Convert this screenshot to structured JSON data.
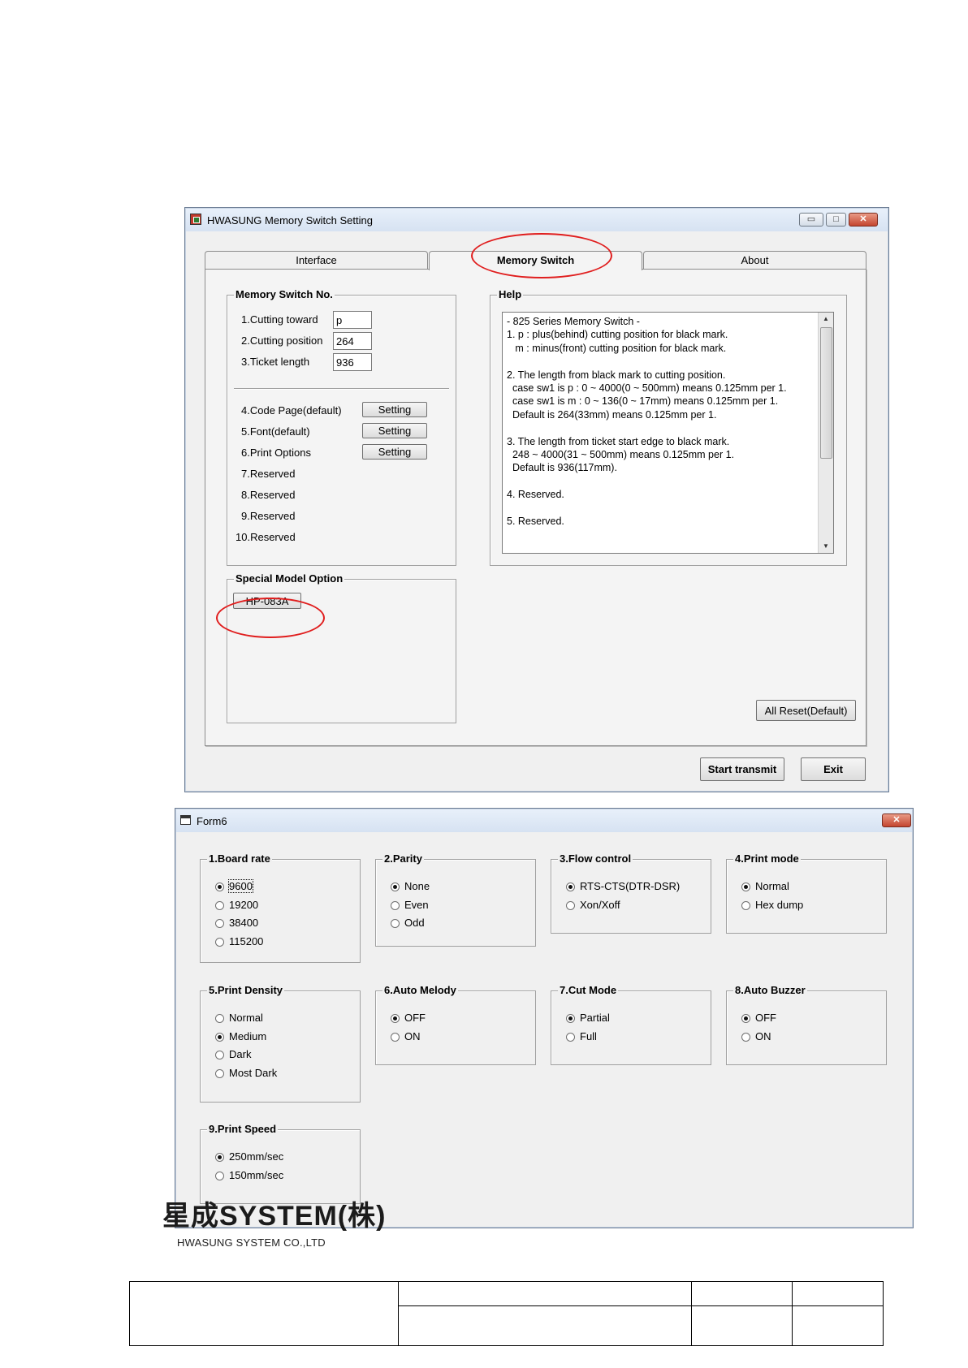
{
  "memory_window": {
    "title": "HWASUNG Memory Switch Setting",
    "caption_buttons": {
      "minimize": "▭",
      "maximize": "□",
      "close": "✕"
    },
    "tabs": [
      {
        "label": "Interface",
        "active": false
      },
      {
        "label": "Memory Switch",
        "active": true
      },
      {
        "label": "About",
        "active": false
      }
    ],
    "memory_switch_group": {
      "title": "Memory Switch No.",
      "fields": [
        {
          "label": "1.Cutting toward",
          "value": "p"
        },
        {
          "label": "2.Cutting position",
          "value": "264"
        },
        {
          "label": "3.Ticket length",
          "value": "936"
        }
      ],
      "settings": [
        {
          "label": "4.Code Page(default)",
          "button": "Setting"
        },
        {
          "label": "5.Font(default)",
          "button": "Setting"
        },
        {
          "label": "6.Print Options",
          "button": "Setting"
        }
      ],
      "reserved": [
        "7.Reserved",
        "8.Reserved",
        "9.Reserved",
        "10.Reserved"
      ]
    },
    "help": {
      "title": "Help",
      "text": "- 825 Series Memory Switch -\n1. p : plus(behind) cutting position for black mark.\n   m : minus(front) cutting position for black mark.\n\n2. The length from black mark to cutting position.\n  case sw1 is p : 0 ~ 4000(0 ~ 500mm) means 0.125mm per 1.\n  case sw1 is m : 0 ~ 136(0 ~ 17mm) means 0.125mm per 1.\n  Default is 264(33mm) means 0.125mm per 1.\n\n3. The length from ticket start edge to black mark.\n  248 ~ 4000(31 ~ 500mm) means 0.125mm per 1.\n  Default is 936(117mm).\n\n4. Reserved.\n\n5. Reserved."
    },
    "special_model": {
      "title": "Special Model Option",
      "button": "HP-083A"
    },
    "all_reset_button": "All Reset(Default)",
    "start_transmit_button": "Start transmit",
    "exit_button": "Exit"
  },
  "form6": {
    "title": "Form6",
    "close_button": "✕",
    "groups": [
      {
        "title": "1.Board rate",
        "options": [
          "9600",
          "19200",
          "38400",
          "115200"
        ],
        "selected": 0
      },
      {
        "title": "2.Parity",
        "options": [
          "None",
          "Even",
          "Odd"
        ],
        "selected": 0
      },
      {
        "title": "3.Flow control",
        "options": [
          "RTS-CTS(DTR-DSR)",
          "Xon/Xoff"
        ],
        "selected": 0
      },
      {
        "title": "4.Print mode",
        "options": [
          "Normal",
          "Hex dump"
        ],
        "selected": 0
      },
      {
        "title": "5.Print Density",
        "options": [
          "Normal",
          "Medium",
          "Dark",
          "Most Dark"
        ],
        "selected": 1
      },
      {
        "title": "6.Auto Melody",
        "options": [
          "OFF",
          "ON"
        ],
        "selected": 0
      },
      {
        "title": "7.Cut Mode",
        "options": [
          "Partial",
          "Full"
        ],
        "selected": 0
      },
      {
        "title": "8.Auto Buzzer",
        "options": [
          "OFF",
          "ON"
        ],
        "selected": 0
      },
      {
        "title": "9.Print Speed",
        "options": [
          "250mm/sec",
          "150mm/sec"
        ],
        "selected": 0
      }
    ]
  },
  "logo": {
    "mark": "星成SYSTEM(株)",
    "sub": "HWASUNG SYSTEM CO.,LTD"
  },
  "colors": {
    "annotation": "#e01e1e",
    "window_bg": "#f0f0f0",
    "panel_bg": "#f4f4f4"
  }
}
